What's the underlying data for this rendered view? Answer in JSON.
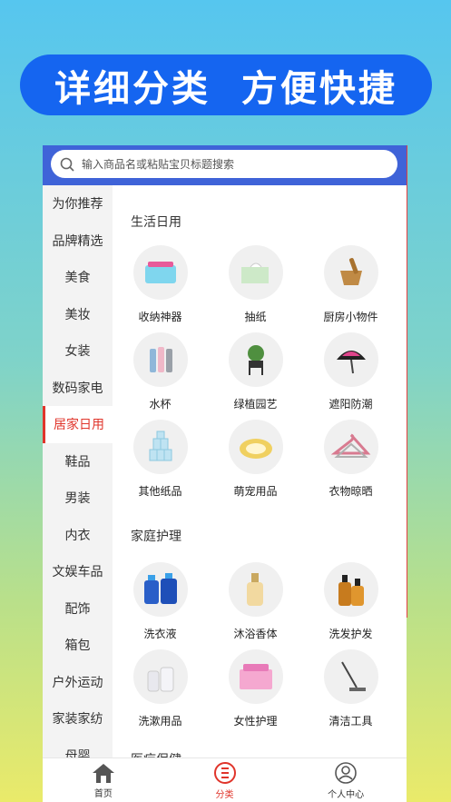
{
  "banner": {
    "text": "详细分类  方便快捷"
  },
  "search": {
    "placeholder": "输入商品名或粘贴宝贝标题搜索"
  },
  "sidebar": {
    "items": [
      {
        "label": "为你推荐"
      },
      {
        "label": "品牌精选"
      },
      {
        "label": "美食"
      },
      {
        "label": "美妆"
      },
      {
        "label": "女装"
      },
      {
        "label": "数码家电"
      },
      {
        "label": "居家日用"
      },
      {
        "label": "鞋品"
      },
      {
        "label": "男装"
      },
      {
        "label": "内衣"
      },
      {
        "label": "文娱车品"
      },
      {
        "label": "配饰"
      },
      {
        "label": "箱包"
      },
      {
        "label": "户外运动"
      },
      {
        "label": "家装家纺"
      },
      {
        "label": "母婴"
      }
    ],
    "active_index": 6
  },
  "sections": [
    {
      "title": "生活日用",
      "items": [
        {
          "label": "收纳神器",
          "icon": "storage-box-icon"
        },
        {
          "label": "抽纸",
          "icon": "tissue-icon"
        },
        {
          "label": "厨房小物件",
          "icon": "mortar-icon"
        },
        {
          "label": "水杯",
          "icon": "cup-icon"
        },
        {
          "label": "绿植园艺",
          "icon": "plant-icon"
        },
        {
          "label": "遮阳防潮",
          "icon": "umbrella-icon"
        },
        {
          "label": "其他纸品",
          "icon": "toilet-paper-icon"
        },
        {
          "label": "萌宠用品",
          "icon": "pet-bed-icon"
        },
        {
          "label": "衣物晾晒",
          "icon": "hanger-icon"
        }
      ]
    },
    {
      "title": "家庭护理",
      "items": [
        {
          "label": "洗衣液",
          "icon": "detergent-icon"
        },
        {
          "label": "沐浴香体",
          "icon": "body-wash-icon"
        },
        {
          "label": "洗发护发",
          "icon": "shampoo-icon"
        },
        {
          "label": "洗漱用品",
          "icon": "toiletries-icon"
        },
        {
          "label": "女性护理",
          "icon": "pads-icon"
        },
        {
          "label": "清洁工具",
          "icon": "mop-icon"
        }
      ]
    },
    {
      "title": "医疗保健",
      "items": []
    }
  ],
  "tabbar": {
    "items": [
      {
        "label": "首页",
        "icon": "home-icon"
      },
      {
        "label": "分类",
        "icon": "category-icon"
      },
      {
        "label": "个人中心",
        "icon": "user-icon"
      }
    ],
    "active_index": 1
  },
  "colors": {
    "header": "#3f63d8",
    "accent": "#e0352b",
    "banner": "#1565f0"
  }
}
